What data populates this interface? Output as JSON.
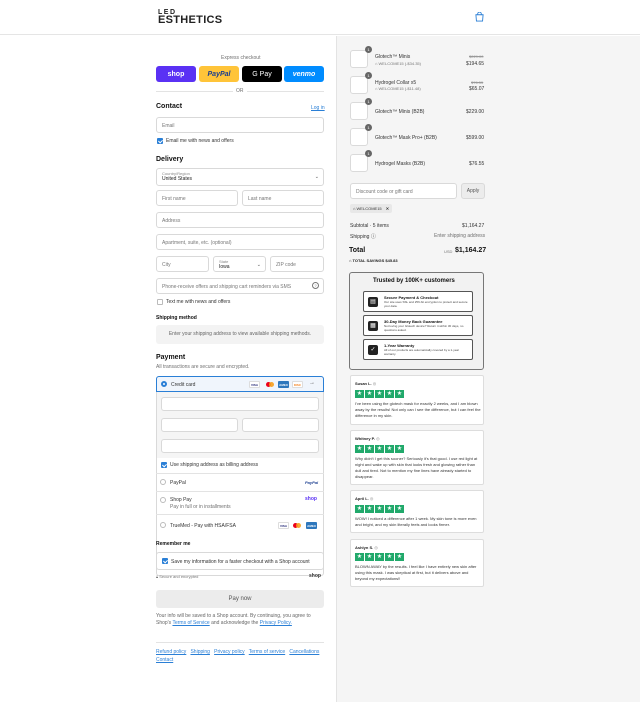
{
  "header": {
    "logo_top": "LED",
    "logo_bottom": "ESTHETICS",
    "cart_icon": "shopping-bag-icon"
  },
  "express": {
    "title": "Express checkout",
    "buttons": [
      "shop",
      "PayPal",
      "G Pay",
      "venmo"
    ],
    "or": "OR"
  },
  "contact": {
    "title": "Contact",
    "login": "Log in",
    "email_placeholder": "Email",
    "newsletter": "Email me with news and offers"
  },
  "delivery": {
    "title": "Delivery",
    "country_label": "Country/Region",
    "country": "United States",
    "first_name": "First name",
    "last_name": "Last name",
    "address": "Address",
    "apartment": "Apartment, suite, etc. (optional)",
    "city": "City",
    "state_label": "State",
    "state": "Iowa",
    "zip": "ZIP code",
    "phone": "Phone-receive offers and shipping cart reminders via SMS",
    "text_me": "Text me with news and offers"
  },
  "shipping": {
    "title": "Shipping method",
    "placeholder": "Enter your shipping address to view available shipping methods."
  },
  "payment": {
    "title": "Payment",
    "subtitle": "All transactions are secure and encrypted.",
    "credit_card": "Credit card",
    "billing_same": "Use shipping address as billing address",
    "paypal": "PayPal",
    "paypal_logo": "PayPal",
    "shop_pay": "Shop Pay",
    "shop_pay_sub": "Pay in full or in installments",
    "shop_pay_logo": "shop",
    "truemed": "TrueMed - Pay with HSA/FSA"
  },
  "remember": {
    "title": "Remember me",
    "save_info": "Save my information for a faster checkout with a Shop account",
    "secure": "Secure and encrypted",
    "shop_logo": "shop"
  },
  "pay_now": "Pay now",
  "terms": {
    "text": "Your info will be saved to a Shop account. By continuing, you agree to Shop's",
    "tos": "Terms of Service",
    "and": "and acknowledge the",
    "privacy": "Privacy Policy."
  },
  "footer_links": [
    "Refund policy",
    "Shipping",
    "Privacy policy",
    "Terms of service",
    "Cancellations",
    "Contact"
  ],
  "order": {
    "items": [
      {
        "qty": "1",
        "name": "Glotech™ Minis",
        "discount": "WELCOME15 (-$34.35)",
        "old_price": "$229.00",
        "price": "$194.65"
      },
      {
        "qty": "1",
        "name": "Hydrogel Collar x5",
        "discount": "WELCOME15 (-$11.48)",
        "old_price": "$76.55",
        "price": "$65.07"
      },
      {
        "qty": "1",
        "name": "Glotech™ Minis (B2B)",
        "discount": "",
        "old_price": "",
        "price": "$229.00"
      },
      {
        "qty": "1",
        "name": "Glotech™ Mask Pro+ (B2B)",
        "discount": "",
        "old_price": "",
        "price": "$599.00"
      },
      {
        "qty": "1",
        "name": "Hydrogel Masks (B2B)",
        "discount": "",
        "old_price": "",
        "price": "$76.55"
      }
    ],
    "discount_placeholder": "Discount code or gift card",
    "apply": "Apply",
    "applied_code": "WELCOME15",
    "subtotal_label": "Subtotal · 5 items",
    "subtotal": "$1,164.27",
    "shipping_label": "Shipping",
    "shipping_value": "Enter shipping address",
    "total_label": "Total",
    "currency": "USD",
    "total": "$1,164.27",
    "savings_label": "TOTAL SAVINGS",
    "savings": "$45.83"
  },
  "trust": {
    "title": "Trusted by 100K+ customers",
    "boxes": [
      {
        "icon": "lock-card-icon",
        "title": "Secure Payment & Checkout",
        "sub": "Our site uses SSL and 256-bit encryption to protect and secure your data."
      },
      {
        "icon": "calendar-icon",
        "title": "30-Day Money Back Guarantee",
        "sub": "Not loving your Glotech device? Return it within 30 days, no questions asked."
      },
      {
        "icon": "shield-check-icon",
        "title": "1-Year Warranty",
        "sub": "All of our products are automatically covered by a 1-year warranty."
      }
    ]
  },
  "reviews": [
    {
      "name": "Susan L.",
      "text": "I've been using the glotech mask for exactly 2 weeks, and I am blown away by the results! Not only can I see the difference, but I can feel the difference in my skin."
    },
    {
      "name": "Whitney P.",
      "text": "Why didn't I get this sooner? Seriously it's that good. I use red light at night and wake up with skin that looks fresh and glowing rather than dull and tired. Not to mention my fine lines have already started to disappear."
    },
    {
      "name": "April L.",
      "text": "WOW! I noticed a difference after 1 week. My skin tone is more even and bright, and my skin literally feels and looks firmer."
    },
    {
      "name": "Ashlyn S.",
      "text": "BLOWN AWAY by the results. I feel like I have entirely new skin after using this mask. I was skeptical at first, but it delivers above and beyond my expectations!!"
    }
  ],
  "colors": {
    "accent": "#2a7fd6",
    "star_green": "#21a96b",
    "shop_purple": "#5a31f4",
    "paypal_yellow": "#ffc439",
    "venmo_blue": "#008cff"
  }
}
